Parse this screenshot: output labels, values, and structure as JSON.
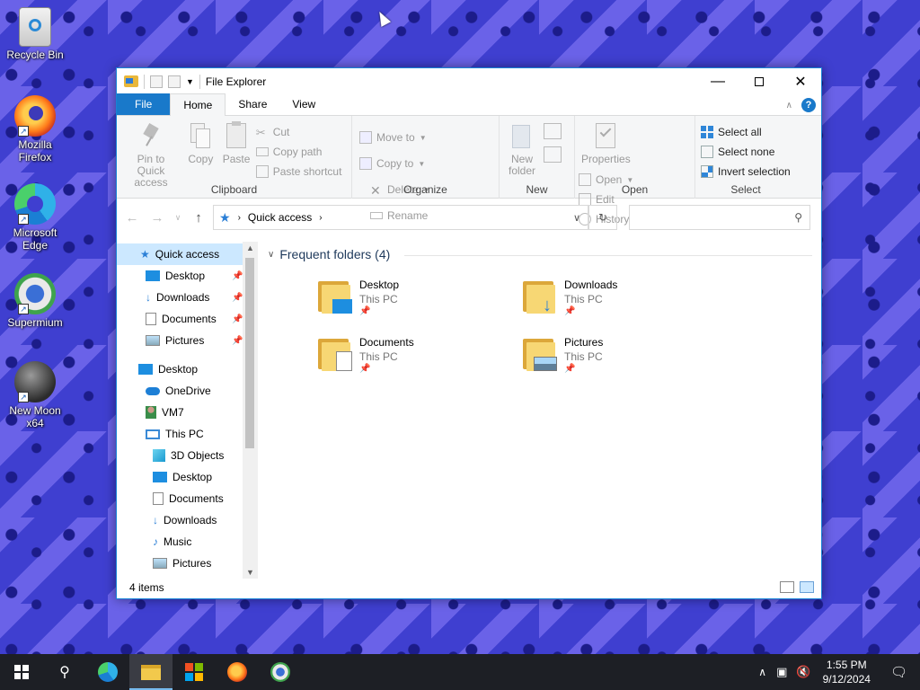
{
  "desktop": {
    "icons": [
      {
        "label": "Recycle Bin"
      },
      {
        "label": "Mozilla Firefox"
      },
      {
        "label": "Microsoft Edge"
      },
      {
        "label": "Supermium"
      },
      {
        "label": "New Moon x64"
      }
    ]
  },
  "window": {
    "title": "File Explorer",
    "tabs": {
      "file": "File",
      "home": "Home",
      "share": "Share",
      "view": "View"
    },
    "help": "?"
  },
  "ribbon": {
    "clipboard": {
      "label": "Clipboard",
      "pin": "Pin to Quick access",
      "copy": "Copy",
      "paste": "Paste",
      "cut": "Cut",
      "copy_path": "Copy path",
      "paste_shortcut": "Paste shortcut"
    },
    "organize": {
      "label": "Organize",
      "move_to": "Move to",
      "copy_to": "Copy to",
      "delete": "Delete",
      "rename": "Rename"
    },
    "new": {
      "label": "New",
      "new_folder": "New folder"
    },
    "open": {
      "label": "Open",
      "properties": "Properties",
      "open": "Open",
      "edit": "Edit",
      "history": "History"
    },
    "select": {
      "label": "Select",
      "select_all": "Select all",
      "select_none": "Select none",
      "invert": "Invert selection"
    }
  },
  "address": {
    "location": "Quick access",
    "search_placeholder": ""
  },
  "nav": {
    "quick_access": "Quick access",
    "pinned": [
      "Desktop",
      "Downloads",
      "Documents",
      "Pictures"
    ],
    "desktop": "Desktop",
    "onedrive": "OneDrive",
    "user": "VM7",
    "this_pc": "This PC",
    "pc_items": [
      "3D Objects",
      "Desktop",
      "Documents",
      "Downloads",
      "Music",
      "Pictures"
    ]
  },
  "content": {
    "section": "Frequent folders (4)",
    "folders": [
      {
        "name": "Desktop",
        "location": "This PC"
      },
      {
        "name": "Downloads",
        "location": "This PC"
      },
      {
        "name": "Documents",
        "location": "This PC"
      },
      {
        "name": "Pictures",
        "location": "This PC"
      }
    ]
  },
  "status": {
    "items": "4 items"
  },
  "taskbar": {
    "time": "1:55 PM",
    "date": "9/12/2024"
  },
  "colors": {
    "accent": "#1979ca",
    "selection": "#cce8ff",
    "taskbar": "#1d1f25"
  }
}
